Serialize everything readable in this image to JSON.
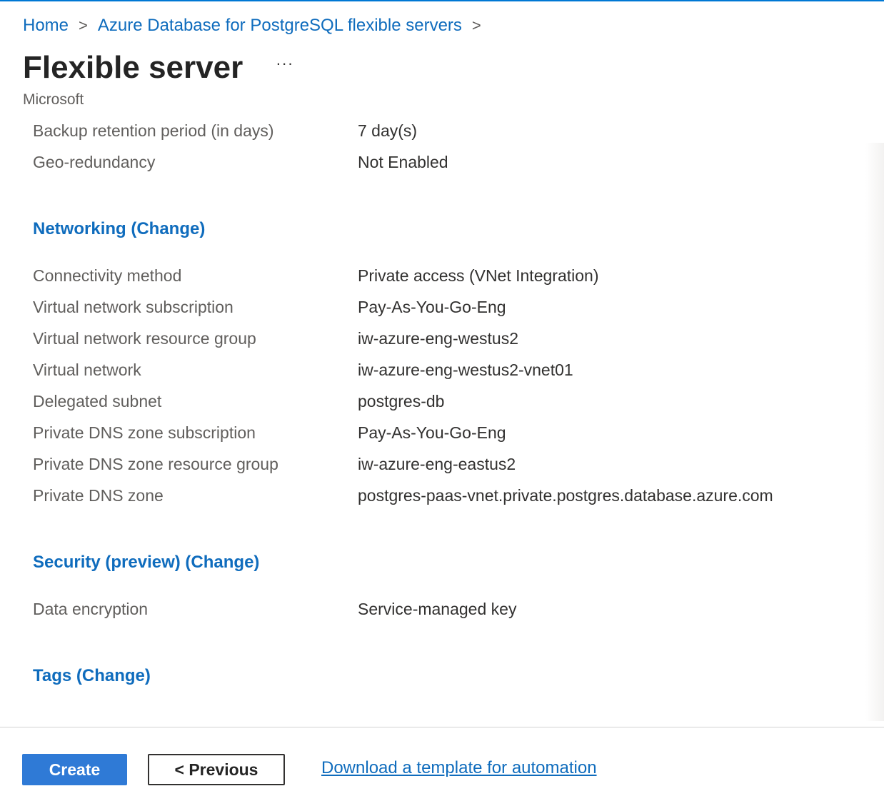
{
  "breadcrumb": {
    "home": "Home",
    "parent": "Azure Database for PostgreSQL flexible servers",
    "separator": ">"
  },
  "page": {
    "title": "Flexible server",
    "more_label": "···",
    "publisher": "Microsoft"
  },
  "backup": {
    "rows": [
      {
        "label": "Backup retention period (in days)",
        "value": "7 day(s)"
      },
      {
        "label": "Geo-redundancy",
        "value": "Not Enabled"
      }
    ]
  },
  "networking": {
    "heading": "Networking (Change)",
    "rows": [
      {
        "label": "Connectivity method",
        "value": "Private access (VNet Integration)"
      },
      {
        "label": "Virtual network subscription",
        "value": "Pay-As-You-Go-Eng"
      },
      {
        "label": "Virtual network resource group",
        "value": "iw-azure-eng-westus2"
      },
      {
        "label": "Virtual network",
        "value": "iw-azure-eng-westus2-vnet01"
      },
      {
        "label": "Delegated subnet",
        "value": "postgres-db"
      },
      {
        "label": "Private DNS zone subscription",
        "value": "Pay-As-You-Go-Eng"
      },
      {
        "label": "Private DNS zone resource group",
        "value": "iw-azure-eng-eastus2"
      },
      {
        "label": "Private DNS zone",
        "value": "postgres-paas-vnet.private.postgres.database.azure.com"
      }
    ]
  },
  "security": {
    "heading": "Security (preview) (Change)",
    "rows": [
      {
        "label": "Data encryption",
        "value": "Service-managed key"
      }
    ]
  },
  "tags": {
    "heading": "Tags (Change)"
  },
  "footer": {
    "create_label": "Create",
    "previous_label": "< Previous",
    "download_label": "Download a template for automation"
  },
  "colors": {
    "accent": "#0f6cbd",
    "primary_button": "#2f7ad6"
  }
}
